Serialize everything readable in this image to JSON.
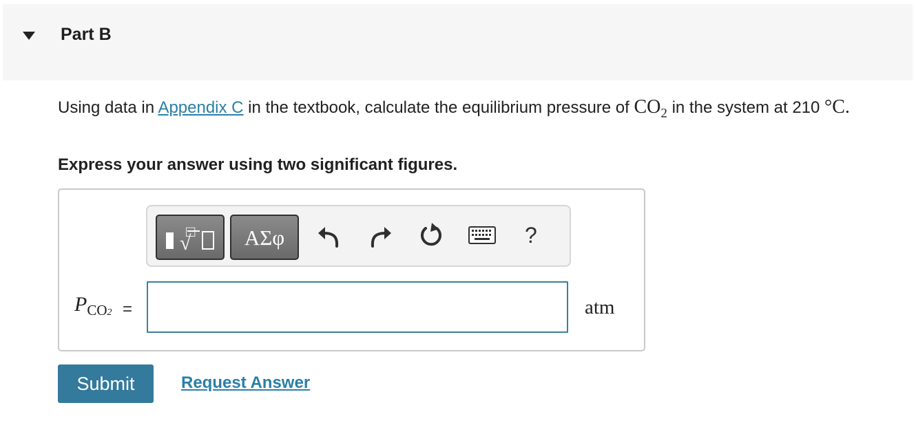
{
  "part": {
    "title": "Part B"
  },
  "question": {
    "text_before": "Using data in ",
    "link": "Appendix C",
    "text_middle": " in the textbook, calculate the equilibrium pressure of ",
    "species": "CO",
    "species_subscript": "2",
    "text_after": " in the system at 210 ",
    "unit": "°C.",
    "instruction": "Express your answer using two significant figures."
  },
  "toolbar": {
    "templates_icon": "templates-icon",
    "symbols_label": "ΑΣφ",
    "undo_icon": "undo-icon",
    "redo_icon": "redo-icon",
    "reset_icon": "reset-icon",
    "keyboard_icon": "keyboard-icon",
    "help_label": "?"
  },
  "answer": {
    "variable": "P",
    "variable_sub": "CO",
    "variable_sub_sub": "2",
    "equals": "=",
    "value": "",
    "unit": "atm"
  },
  "actions": {
    "submit_label": "Submit",
    "request_label": "Request Answer"
  },
  "colors": {
    "accent": "#337a9c",
    "link": "#2a7fa8",
    "header_bg": "#f6f6f6"
  }
}
